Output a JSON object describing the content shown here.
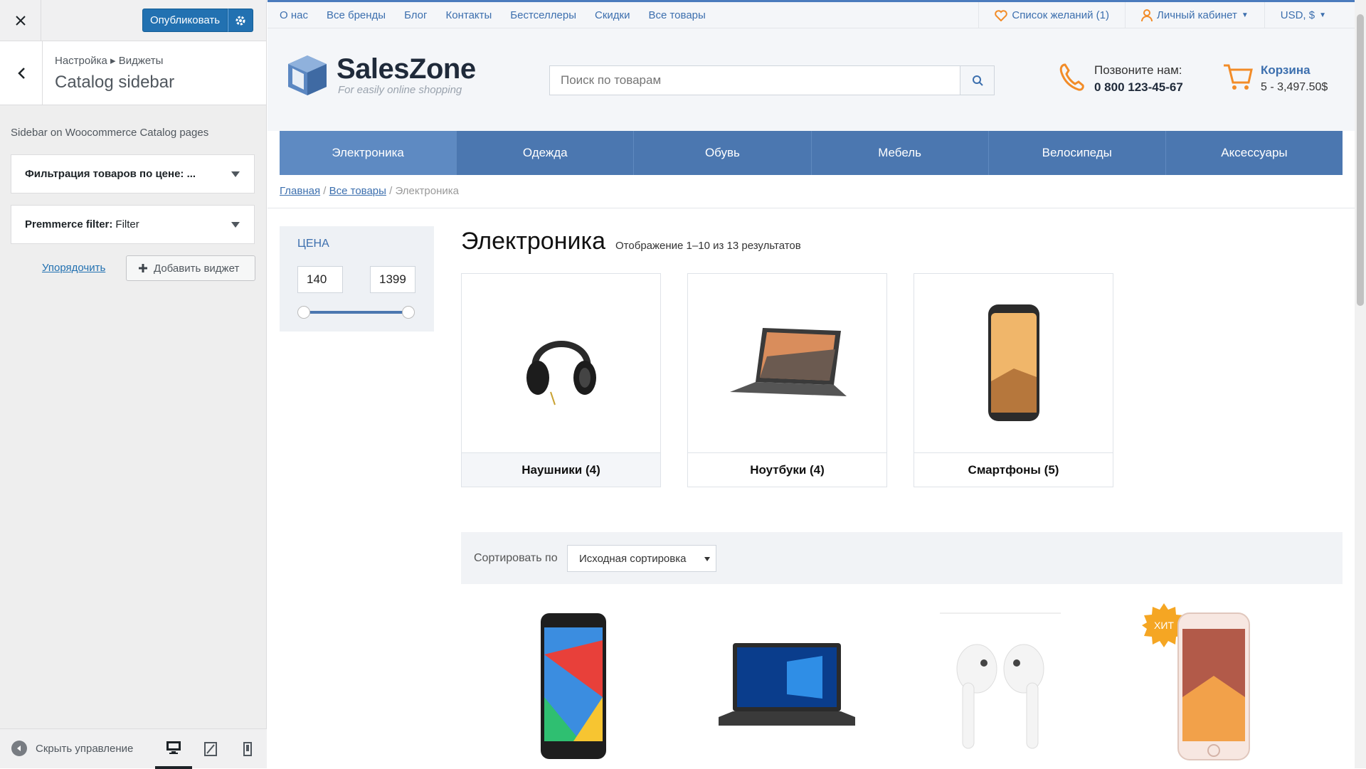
{
  "customizer": {
    "publish_label": "Опубликовать",
    "breadcrumb": "Настройка ▸ Виджеты",
    "section_title": "Catalog sidebar",
    "description": "Sidebar on Woocommerce Catalog pages",
    "widgets": [
      {
        "bold": "Фильтрация товаров по цене: ...",
        "plain": ""
      },
      {
        "bold": "Premmerce filter:",
        "plain": "Filter"
      }
    ],
    "reorder_label": "Упорядочить",
    "add_widget_label": "Добавить виджет",
    "hide_controls_label": "Скрыть управление"
  },
  "site": {
    "top_nav": [
      "О нас",
      "Все бренды",
      "Блог",
      "Контакты",
      "Бестселлеры",
      "Скидки",
      "Все товары"
    ],
    "wishlist": "Список желаний (1)",
    "account": "Личный кабинет",
    "currency": "USD, $",
    "logo_name": "SalesZone",
    "logo_tagline": "For easily online shopping",
    "search_placeholder": "Поиск по товарам",
    "phone_label": "Позвоните нам:",
    "phone_number": "0 800 123-45-67",
    "cart_label": "Корзина",
    "cart_summary": "5 - 3,497.50$",
    "categories": [
      "Электроника",
      "Одежда",
      "Обувь",
      "Мебель",
      "Велосипеды",
      "Аксессуары"
    ],
    "breadcrumbs": {
      "home": "Главная",
      "all": "Все товары",
      "current": "Электроника"
    },
    "price_filter": {
      "title": "ЦЕНА",
      "min": "140",
      "max": "1399"
    },
    "page_title": "Электроника",
    "results": "Отображение 1–10 из 13 результатов",
    "subcategories": [
      "Наушники (4)",
      "Ноутбуки (4)",
      "Смартфоны (5)"
    ],
    "sort_label": "Сортировать по",
    "sort_value": "Исходная сортировка",
    "hit_badge": "ХИТ",
    "colors": {
      "primary": "#4b77b0",
      "accent": "#f5a623",
      "orange": "#f28c28"
    }
  }
}
